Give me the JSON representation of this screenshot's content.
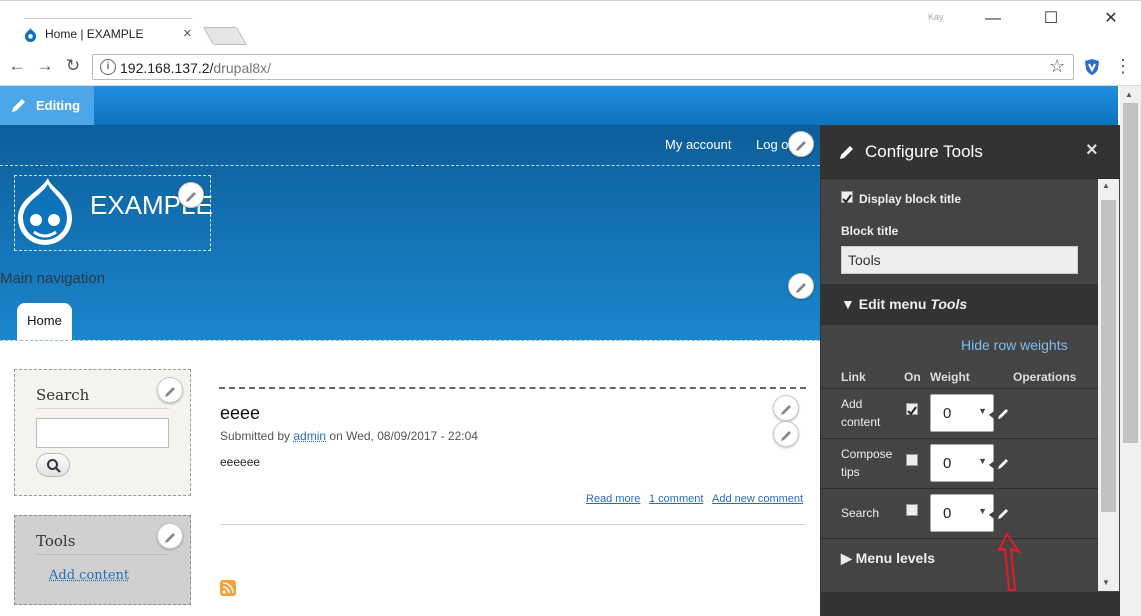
{
  "browser": {
    "tab_title": "Home | EXAMPLE",
    "tab_close": "×",
    "window_user": "Kay",
    "url_host": "192.168.137.2/",
    "url_path": "drupal8x/",
    "minimize": "—",
    "maximize": "☐",
    "close": "✕",
    "back": "←",
    "forward": "→",
    "reload": "↻",
    "info": "i",
    "bookmark": "☆",
    "menu": "⋮"
  },
  "toolbar": {
    "editing_label": "Editing"
  },
  "header": {
    "my_account": "My account",
    "log_out": "Log o",
    "site_name": "EXAMPLE",
    "main_navigation_label": "Main navigation",
    "nav_items": [
      "Home"
    ]
  },
  "sidebar": {
    "search": {
      "title": "Search",
      "input_value": ""
    },
    "tools": {
      "title": "Tools",
      "link": "Add content"
    }
  },
  "node": {
    "title": "eeee",
    "submitted_prefix": "Submitted by ",
    "author": "admin",
    "submitted_suffix": " on Wed, 08/09/2017 - 22:04",
    "body": "eeeeee",
    "links": {
      "read_more": "Read more",
      "comments": "1 comment",
      "add_comment": "Add new comment"
    }
  },
  "tray": {
    "title": "Configure Tools",
    "close": "×",
    "display_title_label": "Display block title",
    "display_title_checked": true,
    "block_title_label": "Block title",
    "block_title_value": "Tools",
    "edit_menu_prefix": "Edit menu ",
    "edit_menu_name": "Tools",
    "hide_weights": "Hide row weights",
    "columns": {
      "link": "Link",
      "on": "On",
      "weight": "Weight",
      "operations": "Operations"
    },
    "rows": [
      {
        "label_line1": "Add",
        "label_line2": "content",
        "on": true,
        "weight": "0"
      },
      {
        "label_line1": "Compose",
        "label_line2": "tips",
        "on": false,
        "weight": "0"
      },
      {
        "label_line1": "Search",
        "label_line2": "",
        "on": false,
        "weight": "0"
      }
    ],
    "menu_levels": "Menu levels"
  },
  "colors": {
    "drupal_blue": "#0d73bd",
    "tray_bg": "#444444",
    "link_blue": "#2a6eb5",
    "annotation_red": "#e31b23"
  }
}
